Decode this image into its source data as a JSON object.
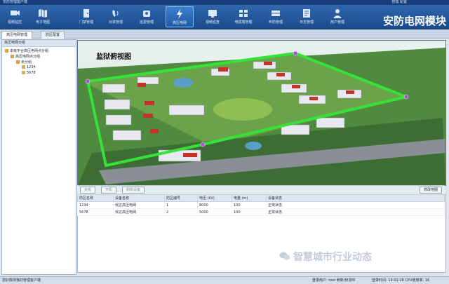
{
  "window": {
    "title": "安防管理客户端",
    "controls": "管理   配置"
  },
  "toolbar": {
    "items": [
      {
        "label": "视频监控",
        "icon": "camera-icon"
      },
      {
        "label": "电子地图",
        "icon": "map-icon"
      },
      {
        "label": "门禁管理",
        "icon": "door-icon"
      },
      {
        "label": "对讲管理",
        "icon": "intercom-icon"
      },
      {
        "label": "巡更管理",
        "icon": "patrol-icon"
      },
      {
        "label": "高压电网",
        "icon": "lightning-icon",
        "active": true
      },
      {
        "label": "视频巡查",
        "icon": "video-patrol-icon"
      },
      {
        "label": "电视墙管理",
        "icon": "tv-wall-icon"
      },
      {
        "label": "布防管理",
        "icon": "defense-icon"
      },
      {
        "label": "日志管理",
        "icon": "log-icon"
      },
      {
        "label": "用户管理",
        "icon": "user-icon"
      }
    ],
    "brand": "安防电网模块"
  },
  "tabs": [
    "高压电网管理",
    "防区配置"
  ],
  "tree": {
    "header": "高压电网分组",
    "nodes": [
      "本级平台高压电网点分组",
      "高压电网点分组",
      "未分组",
      "1234",
      "5678"
    ]
  },
  "map": {
    "title": "监狱俯视图"
  },
  "buttons": {
    "open": "关机",
    "start": "开机",
    "refresh": "刷新设备",
    "edit_map": "修改地图"
  },
  "table": {
    "columns": [
      "防区名称",
      "设备名称",
      "防区编号",
      "电压 (kV)",
      "电量 (m)",
      "设备状态"
    ],
    "rows": [
      [
        "1234",
        "伐达高压电网",
        "1",
        "8000",
        "100",
        "正常状态"
      ],
      [
        "5678",
        "伐达高压电网",
        "2",
        "5000",
        "100",
        "正常状态"
      ]
    ]
  },
  "watermark": "智慧城市行业动态",
  "status": {
    "left": "您好像持我的管理客户端",
    "mid": "登录用户: root  刷新/侦测中",
    "right": "登录时间: 19:02:28  CPU使用率: 16"
  }
}
